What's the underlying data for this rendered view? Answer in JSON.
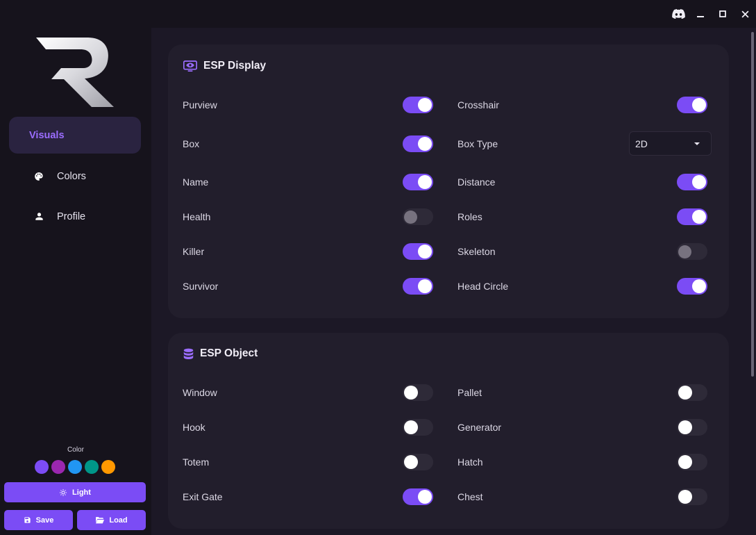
{
  "window_controls": {
    "discord_icon": "discord-icon",
    "minimize_icon": "minimize-icon",
    "maximize_icon": "maximize-icon",
    "close_icon": "close-icon"
  },
  "sidebar": {
    "logo": "R",
    "nav": [
      {
        "label": "Visuals",
        "icon": "eye-icon",
        "active": true
      },
      {
        "label": "Colors",
        "icon": "palette-icon",
        "active": false
      },
      {
        "label": "Profile",
        "icon": "person-icon",
        "active": false
      }
    ],
    "color_label": "Color",
    "swatches": [
      "#7c4cf5",
      "#9b27b0",
      "#2196f3",
      "#009688",
      "#ff9800"
    ],
    "theme_button": "Light",
    "save_button": "Save",
    "load_button": "Load"
  },
  "esp_display": {
    "title": "ESP Display",
    "left": [
      {
        "label": "Purview",
        "on": true
      },
      {
        "label": "Box",
        "on": true
      },
      {
        "label": "Name",
        "on": true
      },
      {
        "label": "Health",
        "on": false
      },
      {
        "label": "Killer",
        "on": true
      },
      {
        "label": "Survivor",
        "on": true
      }
    ],
    "right": [
      {
        "label": "Crosshair",
        "on": true
      },
      {
        "label": "Box Type",
        "select": "2D"
      },
      {
        "label": "Distance",
        "on": true
      },
      {
        "label": "Roles",
        "on": true
      },
      {
        "label": "Skeleton",
        "on": false
      },
      {
        "label": "Head Circle",
        "on": true
      }
    ]
  },
  "esp_object": {
    "title": "ESP Object",
    "left": [
      {
        "label": "Window",
        "on": false
      },
      {
        "label": "Hook",
        "on": false
      },
      {
        "label": "Totem",
        "on": false
      },
      {
        "label": "Exit Gate",
        "on": true
      }
    ],
    "right": [
      {
        "label": "Pallet",
        "on": false
      },
      {
        "label": "Generator",
        "on": false
      },
      {
        "label": "Hatch",
        "on": false
      },
      {
        "label": "Chest",
        "on": false
      }
    ]
  },
  "colors": {
    "accent": "#7b4cf5",
    "sidebar_bg": "#16131c",
    "card_bg": "#221e2c"
  }
}
